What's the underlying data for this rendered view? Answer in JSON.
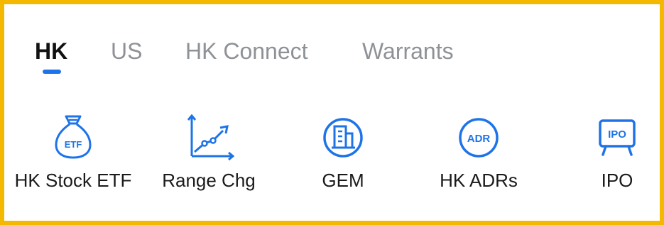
{
  "tabs": [
    {
      "label": "HK",
      "active": true
    },
    {
      "label": "US",
      "active": false
    },
    {
      "label": "HK Connect",
      "active": false
    },
    {
      "label": "Warrants",
      "active": false
    }
  ],
  "shortcuts": [
    {
      "label": "HK Stock ETF",
      "icon": "etf-money-bag-icon",
      "icon_text": "ETF"
    },
    {
      "label": "Range Chg",
      "icon": "range-chart-icon"
    },
    {
      "label": "GEM",
      "icon": "building-circle-icon"
    },
    {
      "label": "HK ADRs",
      "icon": "adr-circle-icon",
      "icon_text": "ADR"
    },
    {
      "label": "IPO",
      "icon": "ipo-billboard-icon",
      "icon_text": "IPO"
    }
  ],
  "colors": {
    "accent": "#1e73e8",
    "border": "#f5b800",
    "active_tab_text": "#111111",
    "inactive_tab_text": "#8e9196"
  }
}
